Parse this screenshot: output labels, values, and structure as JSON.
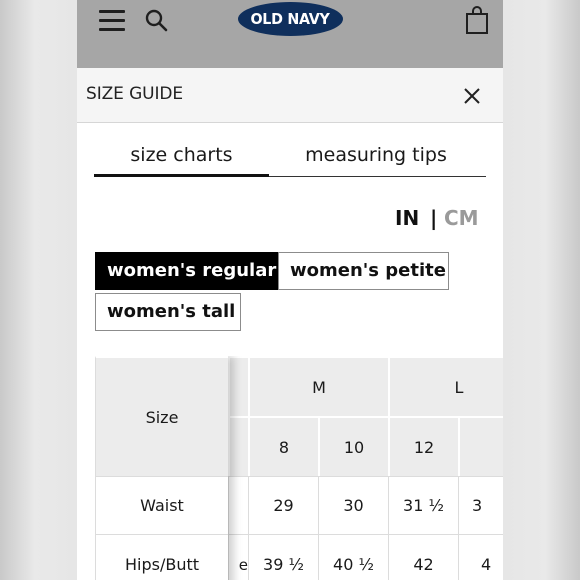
{
  "header": {
    "logo_text": "OLD NAVY",
    "logo_color": "#0f2f5c",
    "bar_color": "#a6a6a6",
    "icons": [
      "menu-icon",
      "search-icon",
      "bag-icon"
    ]
  },
  "size_guide": {
    "title": "SIZE GUIDE",
    "close_icon": "close-icon"
  },
  "tabs": [
    {
      "label": "size charts",
      "active": true
    },
    {
      "label": "measuring tips",
      "active": false
    }
  ],
  "units": {
    "inches": "IN",
    "separator": "|",
    "centimeters": "CM",
    "selected": "IN"
  },
  "fit_options": [
    {
      "label": "women's regular",
      "active": true
    },
    {
      "label": "women's petite",
      "active": false
    },
    {
      "label": "women's tall",
      "active": false
    }
  ],
  "table": {
    "row_header": "Size",
    "size_groups": [
      "M",
      "L"
    ],
    "numeric_sizes": [
      "8",
      "10",
      "12"
    ],
    "rows": [
      {
        "label": "Waist",
        "values": [
          "29",
          "30",
          "31 ½"
        ],
        "partial": "3"
      },
      {
        "label": "Hips/Butt",
        "values": [
          "39 ½",
          "40 ½",
          "42"
        ],
        "partial": "4"
      }
    ],
    "partial_chars": [
      "e"
    ]
  }
}
